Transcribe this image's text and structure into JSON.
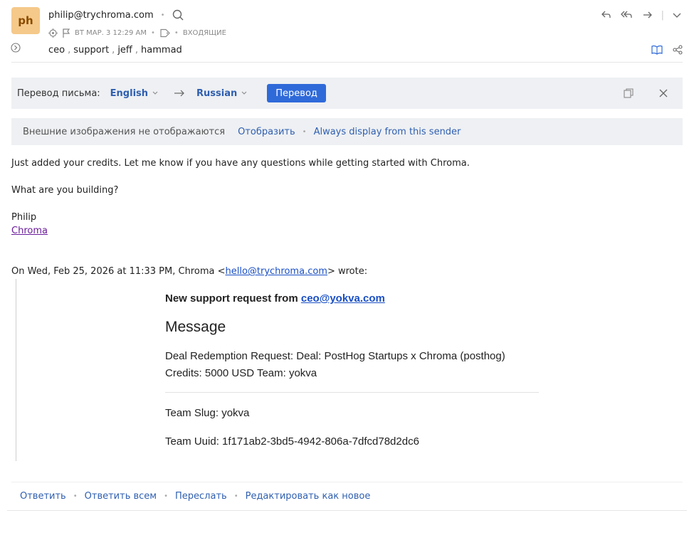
{
  "header": {
    "avatar_initials": "ph",
    "sender": "philip@trychroma.com",
    "date": "ВТ МАР. 3 12:29 AM",
    "folder": "ВХОДЯЩИЕ",
    "recipients": [
      "ceo",
      "support",
      "jeff",
      "hammad"
    ],
    "icons": [
      "search-icon",
      "target-icon",
      "flag-icon",
      "tag-icon",
      "reply-icon",
      "reply-all-icon",
      "forward-icon",
      "chevron-down-icon",
      "expand-icon",
      "book-icon",
      "share-icon"
    ]
  },
  "translate": {
    "label": "Перевод письма:",
    "from_lang": "English",
    "to_lang": "Russian",
    "button": "Перевод",
    "icons": [
      "arrow-right-icon",
      "copy-icon",
      "close-icon"
    ]
  },
  "images": {
    "notice": "Внешние изображения не отображаются",
    "show": "Отобразить",
    "always": "Always display from this sender"
  },
  "body": {
    "line1": "Just added your credits. Let me know if you have any questions while getting started with Chroma.",
    "line2": "What are you building?",
    "sig_name": "Philip",
    "sig_link": "Chroma",
    "quote_prefix": "On Wed, Feb 25, 2026 at 11:33 PM, Chroma <",
    "quote_email": "hello@trychroma.com",
    "quote_suffix": "> wrote:"
  },
  "quoted": {
    "request_prefix": "New support request from ",
    "request_email": "ceo@yokva.com",
    "message_heading": "Message",
    "message_body": "Deal Redemption Request: Deal: PostHog Startups x Chroma (posthog) Credits: 5000 USD Team: yokva",
    "team_slug": "Team Slug: yokva",
    "team_uuid": "Team Uuid: 1f171ab2-3bd5-4942-806a-7dfcd78d2dc6"
  },
  "footer": {
    "reply": "Ответить",
    "reply_all": "Ответить всем",
    "forward": "Переслать",
    "edit_new": "Редактировать как новое"
  },
  "colors": {
    "accent": "#2f6ad9",
    "link": "#2f5fb0",
    "avatar_bg": "#f5c98a",
    "bar_bg": "#eef0f3"
  }
}
